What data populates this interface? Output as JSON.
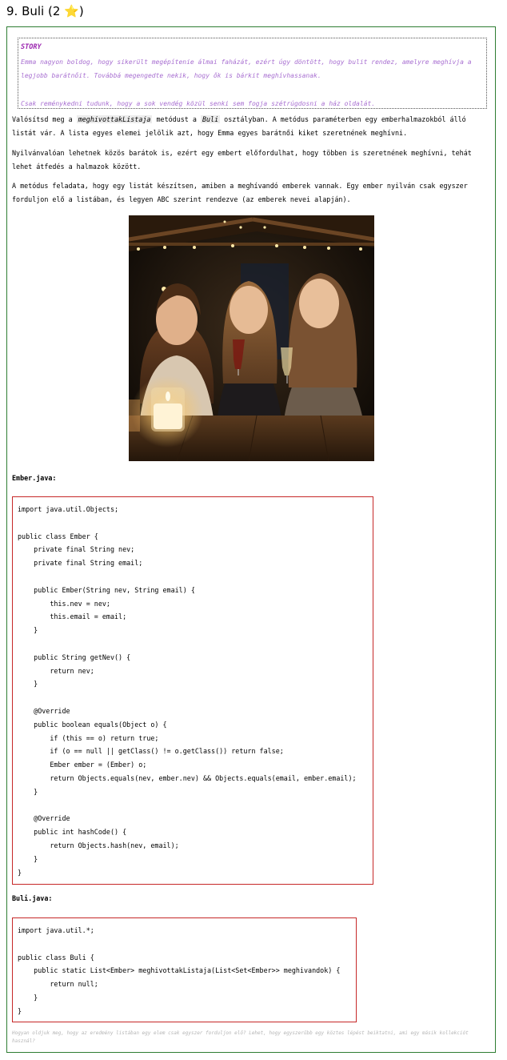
{
  "title": {
    "text": "9. Buli (2 ",
    "star": "⭐",
    "close": ")"
  },
  "story": {
    "label": "STORY",
    "text1": "Emma nagyon boldog, hogy sikerült megépítenie álmai faházát, ezért úgy döntött, hogy bulit rendez, amelyre meghívja a legjobb barátnőit. Továbbá megengedte nekik, hogy ők is bárkit meghívhassanak.",
    "text2": "Csak reménykedni tudunk, hogy a sok vendég közül senki sem fogja szétrúgdosni a ház oldalát."
  },
  "para1": {
    "pre": "Valósítsd meg a ",
    "method": "meghivottakListaja",
    "mid": " metódust a ",
    "cls": "Buli",
    "post": " osztályban. A metódus paraméterben egy emberhalmazokból álló listát vár. A lista egyes elemei jelölik azt, hogy Emma egyes barátnői kiket szeretnének meghívni."
  },
  "para2": "Nyilvánvalóan lehetnek közös barátok is, ezért egy embert előfordulhat, hogy többen is szeretnének meghívni, tehát lehet átfedés a halmazok között.",
  "para3": "A metódus feladata, hogy egy listát készítsen, amiben a meghívandó emberek vannak. Egy ember nyilván csak egyszer forduljon elő a listában, és legyen ABC szerint rendezve (az emberek nevei alapján).",
  "ember_file": {
    "label": "Ember.java:",
    "lines": [
      "import java.util.Objects;",
      "",
      "public class Ember {",
      "    private final String nev;",
      "    private final String email;",
      "",
      "    public Ember(String nev, String email) {",
      "        this.nev = nev;",
      "        this.email = email;",
      "    }",
      "",
      "    public String getNev() {",
      "        return nev;",
      "    }",
      "",
      "    @Override",
      "    public boolean equals(Object o) {",
      "        if (this == o) return true;",
      "        if (o == null || getClass() != o.getClass()) return false;",
      "        Ember ember = (Ember) o;",
      "        return Objects.equals(nev, ember.nev) && Objects.equals(email, ember.email);",
      "    }",
      "",
      "    @Override",
      "    public int hashCode() {",
      "        return Objects.hash(nev, email);",
      "    }",
      "}"
    ]
  },
  "buli_file": {
    "label": "Buli.java:",
    "lines": [
      "import java.util.*;",
      "",
      "public class Buli {",
      "    public static List<Ember> meghivottakListaja(List<Set<Ember>> meghivandok) {",
      "        return null;",
      "    }",
      "}"
    ]
  },
  "footnote": "Hogyan oldjuk meg, hogy az eredmény listában egy elem csak egyszer forduljon elő? Lehet, hogy egyszerűbb egy köztes lépést beiktatni, ami egy másik kollekciót használ?"
}
